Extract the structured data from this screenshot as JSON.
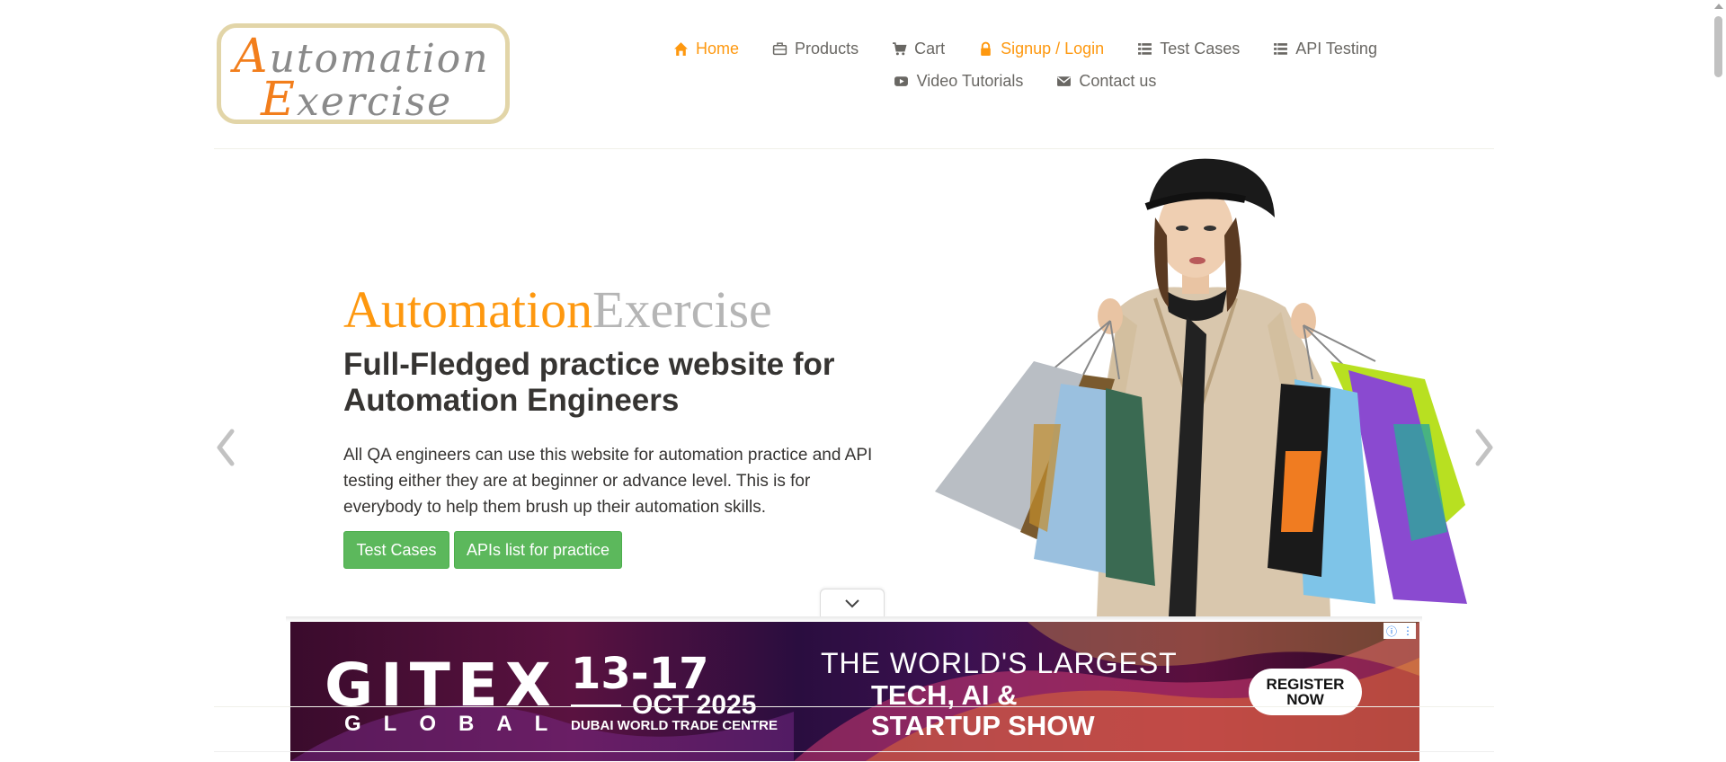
{
  "logo": {
    "line1_cap": "A",
    "line1_rest": "utomation",
    "line2_cap": "E",
    "line2_rest": "xercise"
  },
  "nav": {
    "row1": [
      {
        "label": "Home",
        "icon": "home-icon",
        "state": "active"
      },
      {
        "label": "Products",
        "icon": "briefcase-icon"
      },
      {
        "label": "Cart",
        "icon": "cart-icon"
      },
      {
        "label": "Signup / Login",
        "icon": "lock-icon",
        "state": "highlight"
      },
      {
        "label": "Test Cases",
        "icon": "list-icon"
      },
      {
        "label": "API Testing",
        "icon": "list-icon"
      }
    ],
    "row2": [
      {
        "label": "Video Tutorials",
        "icon": "youtube-play-icon"
      },
      {
        "label": "Contact us",
        "icon": "envelope-icon"
      }
    ]
  },
  "hero": {
    "brand_part1": "Automation",
    "brand_part2": "Exercise",
    "heading": "Full-Fledged practice website for Automation Engineers",
    "description": "All QA engineers can use this website for automation practice and API testing either they are at beginner or advance level. This is for everybody to help them brush up their automation skills.",
    "button_test_cases": "Test Cases",
    "button_apis": "APIs list for practice"
  },
  "ad": {
    "brand": "GITEX",
    "sub": "GLOBAL",
    "dates": "13-17",
    "month": "OCT 2025",
    "venue": "DUBAI WORLD TRADE CENTRE",
    "tagline1": "THE WORLD'S LARGEST",
    "tagline2": "TECH, AI &",
    "tagline3": "STARTUP SHOW",
    "cta_line1": "REGISTER",
    "cta_line2": "NOW",
    "info": "ⓘ",
    "menu": "⋮"
  },
  "colors": {
    "accent": "#FE980F",
    "button_green": "#5cb85c",
    "text": "#696763",
    "heading": "#363432"
  }
}
